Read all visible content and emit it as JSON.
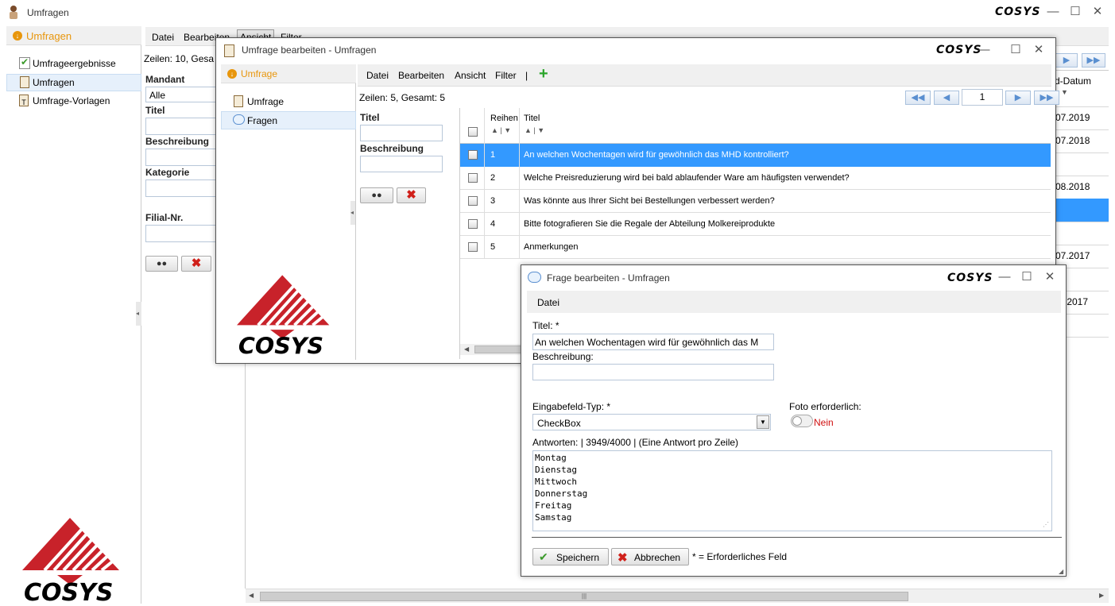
{
  "main": {
    "title": "Umfragen",
    "brand": "COSYS",
    "left_panel": {
      "header": "Umfragen",
      "items": [
        {
          "label": "Umfrageergebnisse",
          "icon": "check-doc-icon"
        },
        {
          "label": "Umfragen",
          "icon": "clipboard-icon"
        },
        {
          "label": "Umfrage-Vorlagen",
          "icon": "template-icon"
        }
      ]
    },
    "menu": [
      "Datei",
      "Bearbeiten",
      "Ansicht",
      "Filter"
    ],
    "rows_info": "Zeilen: 10, Gesa",
    "filters": {
      "mandant_label": "Mandant",
      "mandant_value": "Alle",
      "titel_label": "Titel",
      "beschreibung_label": "Beschreibung",
      "kategorie_label": "Kategorie",
      "filial_label": "Filial-Nr."
    },
    "grid_header": "d-Datum",
    "grid_dates": [
      "07.2019",
      "07.2018",
      "",
      "08.2018",
      "",
      "",
      "07.2017",
      "",
      ".2017",
      ""
    ]
  },
  "edit_window": {
    "title": "Umfrage bearbeiten - Umfragen",
    "left_header": "Umfrage",
    "tree": [
      {
        "label": "Umfrage",
        "icon": "clipboard-icon"
      },
      {
        "label": "Fragen",
        "icon": "speech-bubble-icon"
      }
    ],
    "menu": [
      "Datei",
      "Bearbeiten",
      "Ansicht",
      "Filter",
      "|"
    ],
    "rows_info": "Zeilen: 5, Gesamt: 5",
    "page_number": "1",
    "filter_titel": "Titel",
    "filter_beschreibung": "Beschreibung",
    "columns": [
      "Reihen",
      "Titel"
    ],
    "rows": [
      {
        "num": "1",
        "title": "An welchen Wochentagen wird für gewöhnlich das MHD kontrolliert?",
        "selected": true
      },
      {
        "num": "2",
        "title": "Welche Preisreduzierung wird bei bald ablaufender Ware am häufigsten verwendet?",
        "selected": false
      },
      {
        "num": "3",
        "title": "Was könnte aus Ihrer Sicht bei Bestellungen verbessert werden?",
        "selected": false
      },
      {
        "num": "4",
        "title": "Bitte fotografieren Sie die Regale der Abteilung Molkereiprodukte",
        "selected": false
      },
      {
        "num": "5",
        "title": "Anmerkungen",
        "selected": false
      }
    ]
  },
  "question_window": {
    "title": "Frage bearbeiten - Umfragen",
    "menu": [
      "Datei"
    ],
    "titel_label": "Titel: *",
    "titel_value": "An welchen Wochentagen wird für gewöhnlich das M",
    "beschreibung_label": "Beschreibung:",
    "beschreibung_value": "",
    "typ_label": "Eingabefeld-Typ: *",
    "typ_value": "CheckBox",
    "foto_label": "Foto erforderlich:",
    "foto_value": "Nein",
    "antworten_label": "Antworten: | 3949/4000 | (Eine Antwort pro Zeile)",
    "antworten": "Montag\nDienstag\nMittwoch\nDonnerstag\nFreitag\nSamstag",
    "save_label": "Speichern",
    "cancel_label": "Abbrechen",
    "required_note": "* = Erforderliches Feld"
  },
  "colors": {
    "selection": "#3399ff",
    "accent": "#e8960c",
    "logo_red": "#c8222a",
    "nein_red": "#d01010"
  }
}
